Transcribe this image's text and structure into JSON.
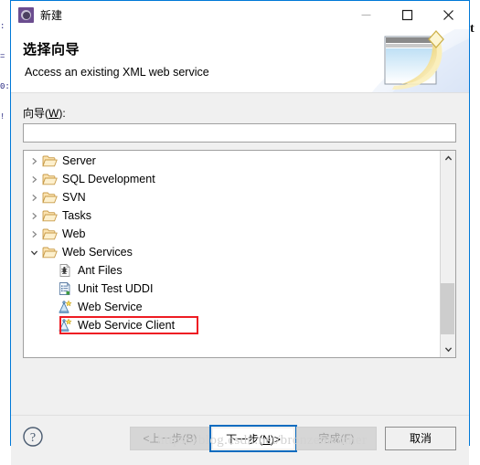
{
  "window": {
    "title": "新建",
    "icon": "wizard-app-icon",
    "controls": {
      "minimize": "minimize-icon",
      "maximize": "maximize-icon",
      "close": "close-icon"
    }
  },
  "banner": {
    "title": "选择向导",
    "subtitle": "Access an existing XML web service",
    "art": "wizard-window-sparkle-art"
  },
  "form": {
    "wizard_label_prefix": "向导(",
    "wizard_label_mnemonic": "W",
    "wizard_label_suffix": "):",
    "wizard_input_value": "",
    "wizard_input_placeholder": ""
  },
  "tree": {
    "items": [
      {
        "label": "Server",
        "level": 0,
        "expanded": false,
        "icon": "folder-icon",
        "highlighted": false
      },
      {
        "label": "SQL Development",
        "level": 0,
        "expanded": false,
        "icon": "folder-icon",
        "highlighted": false
      },
      {
        "label": "SVN",
        "level": 0,
        "expanded": false,
        "icon": "folder-icon",
        "highlighted": false
      },
      {
        "label": "Tasks",
        "level": 0,
        "expanded": false,
        "icon": "folder-icon",
        "highlighted": false
      },
      {
        "label": "Web",
        "level": 0,
        "expanded": false,
        "icon": "folder-icon",
        "highlighted": false
      },
      {
        "label": "Web Services",
        "level": 0,
        "expanded": true,
        "icon": "folder-icon",
        "highlighted": false
      },
      {
        "label": "Ant Files",
        "level": 1,
        "expanded": null,
        "icon": "ant-file-icon",
        "highlighted": false
      },
      {
        "label": "Unit Test UDDI",
        "level": 1,
        "expanded": null,
        "icon": "unit-test-icon",
        "highlighted": false
      },
      {
        "label": "Web Service",
        "level": 1,
        "expanded": null,
        "icon": "web-service-icon",
        "highlighted": false
      },
      {
        "label": "Web Service Client",
        "level": 1,
        "expanded": null,
        "icon": "web-service-client-icon",
        "highlighted": true
      }
    ],
    "highlight_color": "#ee1c23",
    "scrollbar": {
      "up_arrow": "chevron-up-icon",
      "down_arrow": "chevron-down-icon",
      "thumb_position_pct": 62
    }
  },
  "footer": {
    "help": "?",
    "back_label": "<上一步(B)",
    "next_label_prefix": "下一步(",
    "next_label_mnemonic": "N",
    "next_label_suffix": ")>",
    "finish_label": "完成(F)",
    "cancel_label": "取消",
    "back_enabled": false,
    "next_enabled": true,
    "next_focused": true,
    "finish_enabled": false,
    "cancel_enabled": true,
    "focus_color": "#0b6cc0"
  },
  "watermark": {
    "text": "https://blog.csdn.net/bronzehammer"
  },
  "background": {
    "left_lines": [
      ":",
      "=",
      "0:",
      "!"
    ],
    "right_char": "t"
  }
}
